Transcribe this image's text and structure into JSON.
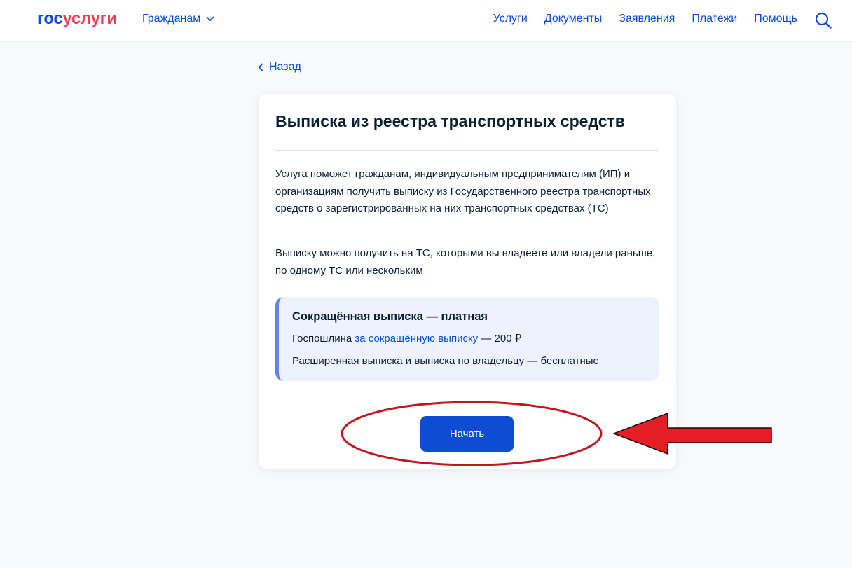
{
  "header": {
    "logo_part1": "гос",
    "logo_part2": "услуги",
    "audience_label": "Гражданам",
    "nav": [
      "Услуги",
      "Документы",
      "Заявления",
      "Платежи",
      "Помощь"
    ]
  },
  "back_label": "Назад",
  "card": {
    "title": "Выписка из реестра транспортных средств",
    "paragraph1": "Услуга поможет гражданам, индивидуальным предпринимателям (ИП) и организациям получить выписку из Государственного реестра транспортных средств о зарегистрированных на них транспортных средствах (ТС)",
    "paragraph2": "Выписку можно получить на ТС, которыми вы владеете или владели раньше, по одному ТС или нескольким",
    "info": {
      "title": "Сокращённая выписка — платная",
      "fee_prefix": "Госпошлина",
      "fee_link": "за сокращённую выписку",
      "fee_suffix": " — 200 ₽",
      "free_note": "Расширенная выписка и выписка по владельцу — бесплатные"
    },
    "start_button": "Начать"
  },
  "colors": {
    "brand_blue": "#0d4cd3",
    "brand_red": "#ee3f58",
    "info_bg": "#edf2fe",
    "info_border": "#6287e3",
    "annotation_red": "#c4161c",
    "arrow_red": "#e31e24"
  },
  "icons": {
    "audience": "chevron-down-icon",
    "search": "search-icon",
    "back": "chevron-left-icon"
  }
}
